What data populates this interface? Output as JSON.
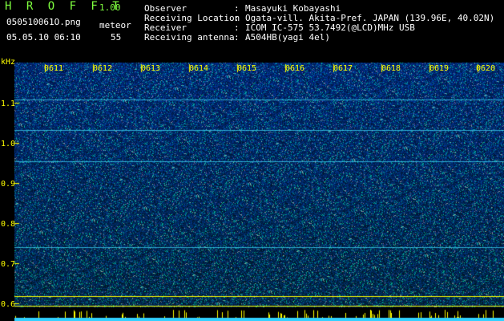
{
  "header": {
    "app_title": "H R O F F T",
    "app_version": "1.00",
    "file_name": "050510061O.png",
    "timestamp": "05.05.10 06:10",
    "meteor_label": "meteor",
    "meteor_count": "55"
  },
  "station_info": [
    {
      "label": "Observer",
      "value": "Masayuki Kobayashi"
    },
    {
      "label": "Receiving Location",
      "value": "Ogata-vill. Akita-Pref. JAPAN (139.96E, 40.02N)"
    },
    {
      "label": "Receiver",
      "value": "ICOM IC-575 53.7492(@LCD)MHz USB"
    },
    {
      "label": "Receiving antenna",
      "value": "A504HB(yagi 4el)"
    }
  ],
  "separator": ":",
  "y_axis": {
    "unit": "kHz",
    "ticks": [
      "1.1",
      "1.0",
      "0.9",
      "0.8",
      "0.7",
      "0.6"
    ]
  },
  "x_axis": {
    "ticks": [
      "0611",
      "0612",
      "0613",
      "0614",
      "0615",
      "0616",
      "0617",
      "0618",
      "0619",
      "0620"
    ]
  },
  "colors": {
    "background": "#000000",
    "header_green": "#7fff3f",
    "axis_yellow": "#ffff00",
    "spectrogram_blue": "#1030b0",
    "echo_line": "#40e0ff"
  }
}
